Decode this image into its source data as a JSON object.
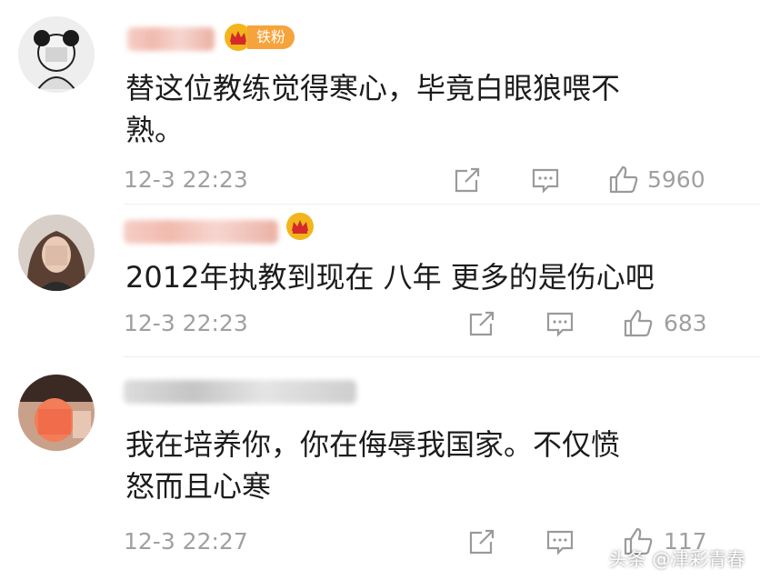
{
  "comments": [
    {
      "fan_badge": "铁粉",
      "text": "替这位教练觉得寒心，毕竟白眼狼喂不\n熟。",
      "timestamp": "12-3 22:23",
      "likes": "5960"
    },
    {
      "fan_badge": "",
      "text": "2012年执教到现在 八年 更多的是伤心吧",
      "timestamp": "12-3 22:23",
      "likes": "683"
    },
    {
      "fan_badge": "",
      "text": "我在培养你，你在侮辱我国家。不仅愤\n怒而且心寒",
      "timestamp": "12-3 22:27",
      "likes": "117"
    }
  ],
  "watermark": "头条 @津彩青春",
  "icons": [
    "share-icon",
    "comment-icon",
    "like-icon",
    "crown-icon"
  ],
  "colors": {
    "badge_orange": "#f7a33b",
    "crown_gold": "#f2b51c",
    "meta_gray": "#a0a0a0"
  }
}
